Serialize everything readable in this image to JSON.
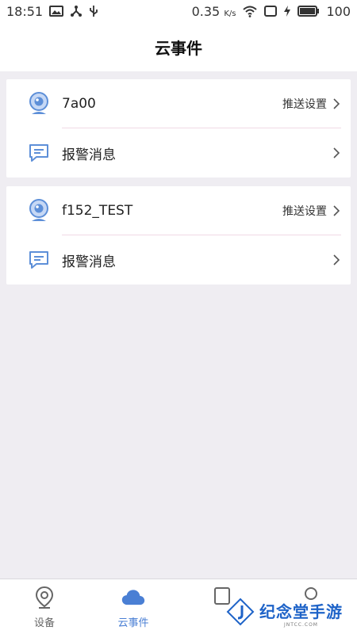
{
  "status_bar": {
    "time": "18:51",
    "network_speed": "0.35",
    "speed_unit": "K/s",
    "battery": "100"
  },
  "header": {
    "title": "云事件"
  },
  "devices": [
    {
      "name": "7a00",
      "push_label": "推送设置",
      "alarm_label": "报警消息"
    },
    {
      "name": "f152_TEST",
      "push_label": "推送设置",
      "alarm_label": "报警消息"
    }
  ],
  "nav": {
    "items": [
      {
        "label": "设备",
        "icon": "location-pin-icon"
      },
      {
        "label": "云事件",
        "icon": "cloud-icon"
      }
    ]
  },
  "watermark": {
    "title": "纪念堂手游",
    "sub": "JNTCC.COM"
  },
  "colors": {
    "accent": "#4a7fd4",
    "background": "#efedf2",
    "divider": "#f0d9e5"
  }
}
